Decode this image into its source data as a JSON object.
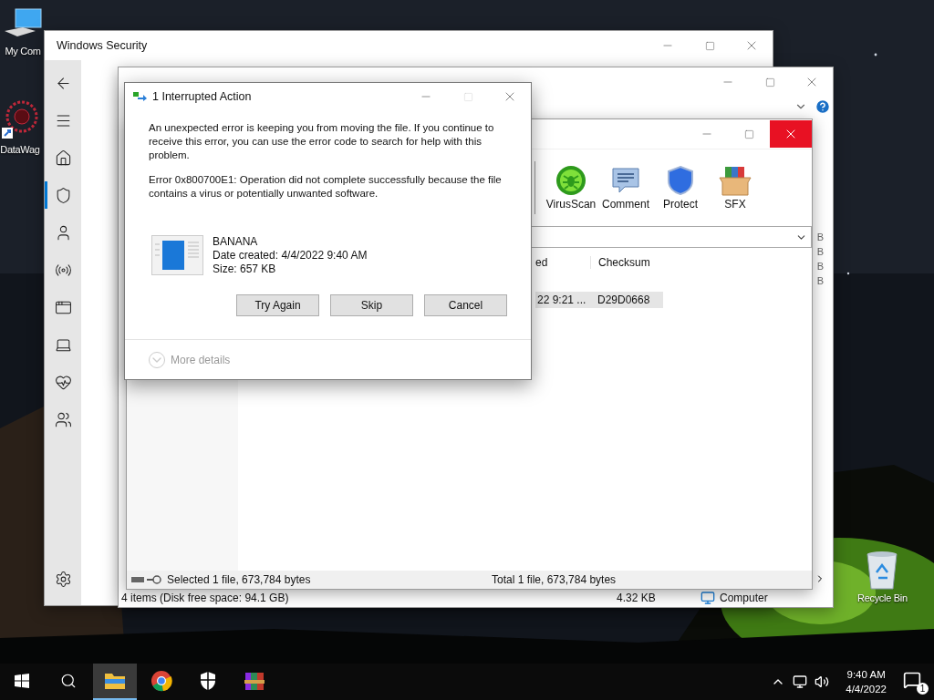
{
  "desktop_icons": [
    {
      "label": "My Com",
      "kind": "computer"
    },
    {
      "label": "DataWag",
      "kind": "app"
    },
    {
      "label": "Recycle Bin",
      "kind": "bin"
    }
  ],
  "security_window": {
    "title": "Windows Security",
    "nav": [
      {
        "kind": "back",
        "selected": false
      },
      {
        "kind": "menu",
        "selected": false
      },
      {
        "kind": "home",
        "selected": false
      },
      {
        "kind": "shield",
        "selected": true
      },
      {
        "kind": "account",
        "selected": false
      },
      {
        "kind": "network",
        "selected": false
      },
      {
        "kind": "app",
        "selected": false
      },
      {
        "kind": "device",
        "selected": false
      },
      {
        "kind": "health",
        "selected": false
      },
      {
        "kind": "family",
        "selected": false
      },
      {
        "kind": "settings",
        "selected": false
      }
    ]
  },
  "explorer_window": {
    "size_fragments": [
      "B",
      "B",
      "B",
      "B"
    ],
    "status": {
      "items": "4 items (Disk free space: 94.1 GB)",
      "size": "4.32 KB",
      "location": "Computer"
    }
  },
  "winrar_window": {
    "tools": [
      {
        "label": "VirusScan",
        "kind": "virus"
      },
      {
        "label": "Comment",
        "kind": "comment"
      },
      {
        "label": "Protect",
        "kind": "protect"
      },
      {
        "label": "SFX",
        "kind": "sfx"
      }
    ],
    "columns": [
      "ed",
      "Checksum"
    ],
    "rows": [
      {
        "cells": [
          "22 9:21 ...",
          "D29D0668"
        ],
        "selected": true
      }
    ],
    "status": {
      "selected": "Selected 1 file, 673,784 bytes",
      "total": "Total 1 file, 673,784 bytes"
    }
  },
  "dialog": {
    "title": "1 Interrupted Action",
    "message": "An unexpected error is keeping you from moving the file. If you continue to receive this error, you can use the error code to search for help with this problem.",
    "error": "Error 0x800700E1: Operation did not complete successfully because the file contains a virus or potentially unwanted software.",
    "file": {
      "name": "BANANA",
      "date": "Date created: 4/4/2022 9:40 AM",
      "size": "Size: 657 KB"
    },
    "buttons": [
      "Try Again",
      "Skip",
      "Cancel"
    ],
    "more": "More details"
  },
  "taskbar": {
    "apps": [
      {
        "kind": "explorer",
        "selected": true
      },
      {
        "kind": "chrome",
        "selected": false
      },
      {
        "kind": "security",
        "selected": false
      },
      {
        "kind": "winrar",
        "selected": false
      }
    ],
    "time": "9:40 AM",
    "date": "4/4/2022",
    "notifications": "1"
  }
}
